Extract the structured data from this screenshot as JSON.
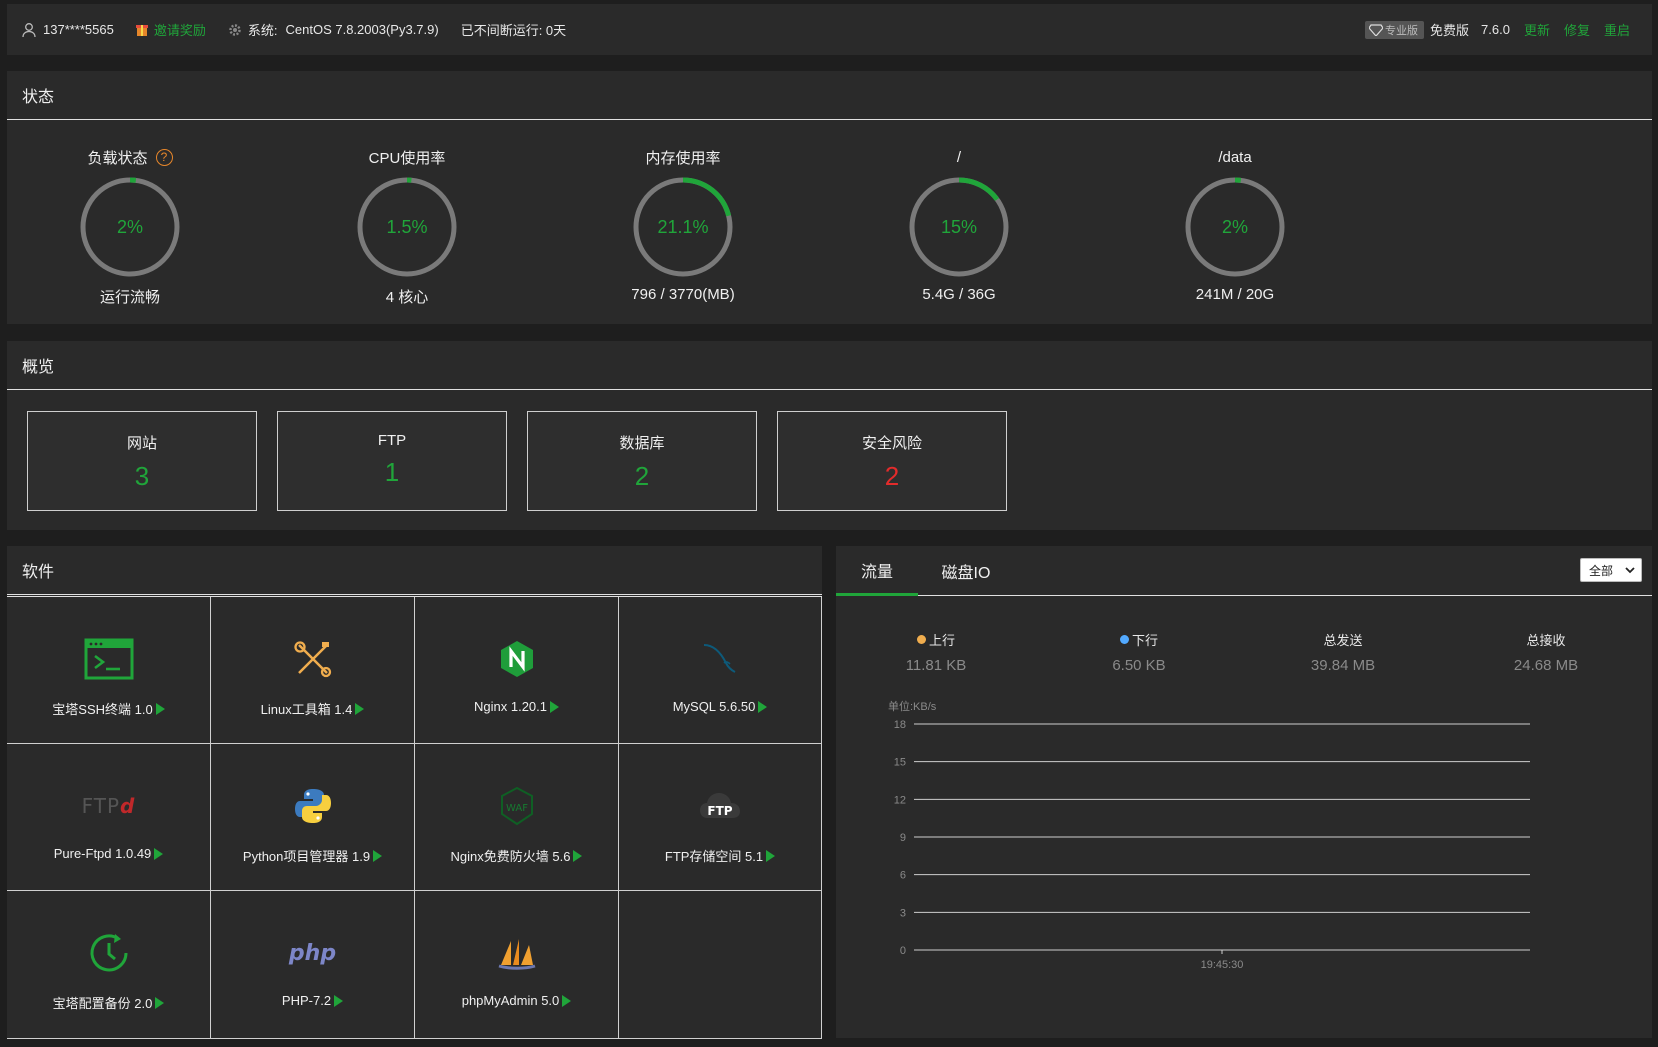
{
  "topbar": {
    "user": "137****5565",
    "invite": "邀请奖励",
    "system_label": "系统:",
    "system_value": "CentOS 7.8.2003(Py3.7.9)",
    "uptime": "已不间断运行: 0天",
    "pro_badge": "专业版",
    "edition": "免费版",
    "version": "7.6.0",
    "update": "更新",
    "repair": "修复",
    "restart": "重启"
  },
  "state": {
    "title": "状态",
    "gauges": [
      {
        "title": "负载状态",
        "value": "2%",
        "percent": 2,
        "sub": "运行流畅",
        "help": "?"
      },
      {
        "title": "CPU使用率",
        "value": "1.5%",
        "percent": 1.5,
        "sub": "4 核心"
      },
      {
        "title": "内存使用率",
        "value": "21.1%",
        "percent": 21.1,
        "sub": "796 / 3770(MB)"
      },
      {
        "title": "/",
        "value": "15%",
        "percent": 15,
        "sub": "5.4G / 36G"
      },
      {
        "title": "/data",
        "value": "2%",
        "percent": 2,
        "sub": "241M / 20G"
      }
    ]
  },
  "overview": {
    "title": "概览",
    "cards": [
      {
        "label": "网站",
        "value": "3"
      },
      {
        "label": "FTP",
        "value": "1"
      },
      {
        "label": "数据库",
        "value": "2"
      },
      {
        "label": "安全风险",
        "value": "2"
      }
    ]
  },
  "software": {
    "title": "软件",
    "items": [
      {
        "name": "宝塔SSH终端 1.0",
        "icon": "terminal-icon"
      },
      {
        "name": "Linux工具箱 1.4",
        "icon": "tools-icon"
      },
      {
        "name": "Nginx 1.20.1",
        "icon": "nginx-icon"
      },
      {
        "name": "MySQL 5.6.50",
        "icon": "mysql-icon"
      },
      {
        "name": "Pure-Ftpd 1.0.49",
        "icon": "pureftpd-icon"
      },
      {
        "name": "Python项目管理器 1.9",
        "icon": "python-icon"
      },
      {
        "name": "Nginx免费防火墙 5.6",
        "icon": "waf-icon"
      },
      {
        "name": "FTP存储空间 5.1",
        "icon": "ftp-storage-icon"
      },
      {
        "name": "宝塔配置备份 2.0",
        "icon": "backup-icon"
      },
      {
        "name": "PHP-7.2",
        "icon": "php-icon"
      },
      {
        "name": "phpMyAdmin 5.0",
        "icon": "phpmyadmin-icon"
      }
    ],
    "ftp_icon_text": "FTP",
    "pureftp_icon_text": "FTP",
    "waf_icon_text": "WAF",
    "php_icon_text": "php"
  },
  "traffic": {
    "tabs": [
      "流量",
      "磁盘IO"
    ],
    "select": "全部",
    "stats": [
      {
        "label": "上行",
        "value": "11.81 KB",
        "dot": "#f0ad4e"
      },
      {
        "label": "下行",
        "value": "6.50 KB",
        "dot": "#52a9ff"
      },
      {
        "label": "总发送",
        "value": "39.84 MB"
      },
      {
        "label": "总接收",
        "value": "24.68 MB"
      }
    ],
    "colors": {
      "accent": "#20a53a",
      "danger": "#e32b2b"
    }
  },
  "chart_data": {
    "type": "line",
    "ylabel": "单位:KB/s",
    "ylim": [
      0,
      18
    ],
    "yticks": [
      "18",
      "15",
      "12",
      "9",
      "6",
      "3",
      "0"
    ],
    "x": [
      "19:45:30"
    ],
    "series": [],
    "grid": true
  }
}
